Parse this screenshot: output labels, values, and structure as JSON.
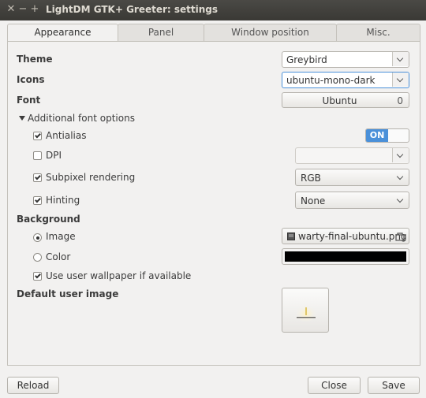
{
  "window": {
    "title": "LightDM GTK+ Greeter: settings",
    "close_symbol": "✕",
    "minimize_symbol": "−",
    "maximize_symbol": "+"
  },
  "tabs": [
    {
      "label": "Appearance",
      "active": true
    },
    {
      "label": "Panel",
      "active": false
    },
    {
      "label": "Window position",
      "active": false
    },
    {
      "label": "Misc.",
      "active": false
    }
  ],
  "appearance": {
    "theme_label": "Theme",
    "theme_value": "Greybird",
    "icons_label": "Icons",
    "icons_value": "ubuntu-mono-dark",
    "font_label": "Font",
    "font_name": "Ubuntu",
    "font_size": "0",
    "additional_font_options_label": "Additional font options",
    "antialias_label": "Antialias",
    "antialias_checked": true,
    "antialias_toggle": "ON",
    "dpi_label": "DPI",
    "dpi_checked": false,
    "dpi_value": "",
    "subpixel_label": "Subpixel rendering",
    "subpixel_checked": true,
    "subpixel_value": "RGB",
    "hinting_label": "Hinting",
    "hinting_checked": true,
    "hinting_value": "None",
    "background_label": "Background",
    "image_label": "Image",
    "image_selected": true,
    "image_file": "warty-final-ubuntu.png",
    "color_label": "Color",
    "color_selected": false,
    "color_value": "#000000",
    "use_wallpaper_label": "Use user wallpaper if available",
    "use_wallpaper_checked": true,
    "default_user_image_label": "Default user image"
  },
  "footer": {
    "reload_label": "Reload",
    "close_label": "Close",
    "save_label": "Save"
  },
  "colors": {
    "accent": "#4a90d9",
    "titlebar": "#3c3b37",
    "window_bg": "#f2f1f0"
  },
  "icons": {
    "file_icon": "image-file-icon",
    "open_icon": "open-folder-icon",
    "user_image_icon": "candle-light-icon"
  }
}
